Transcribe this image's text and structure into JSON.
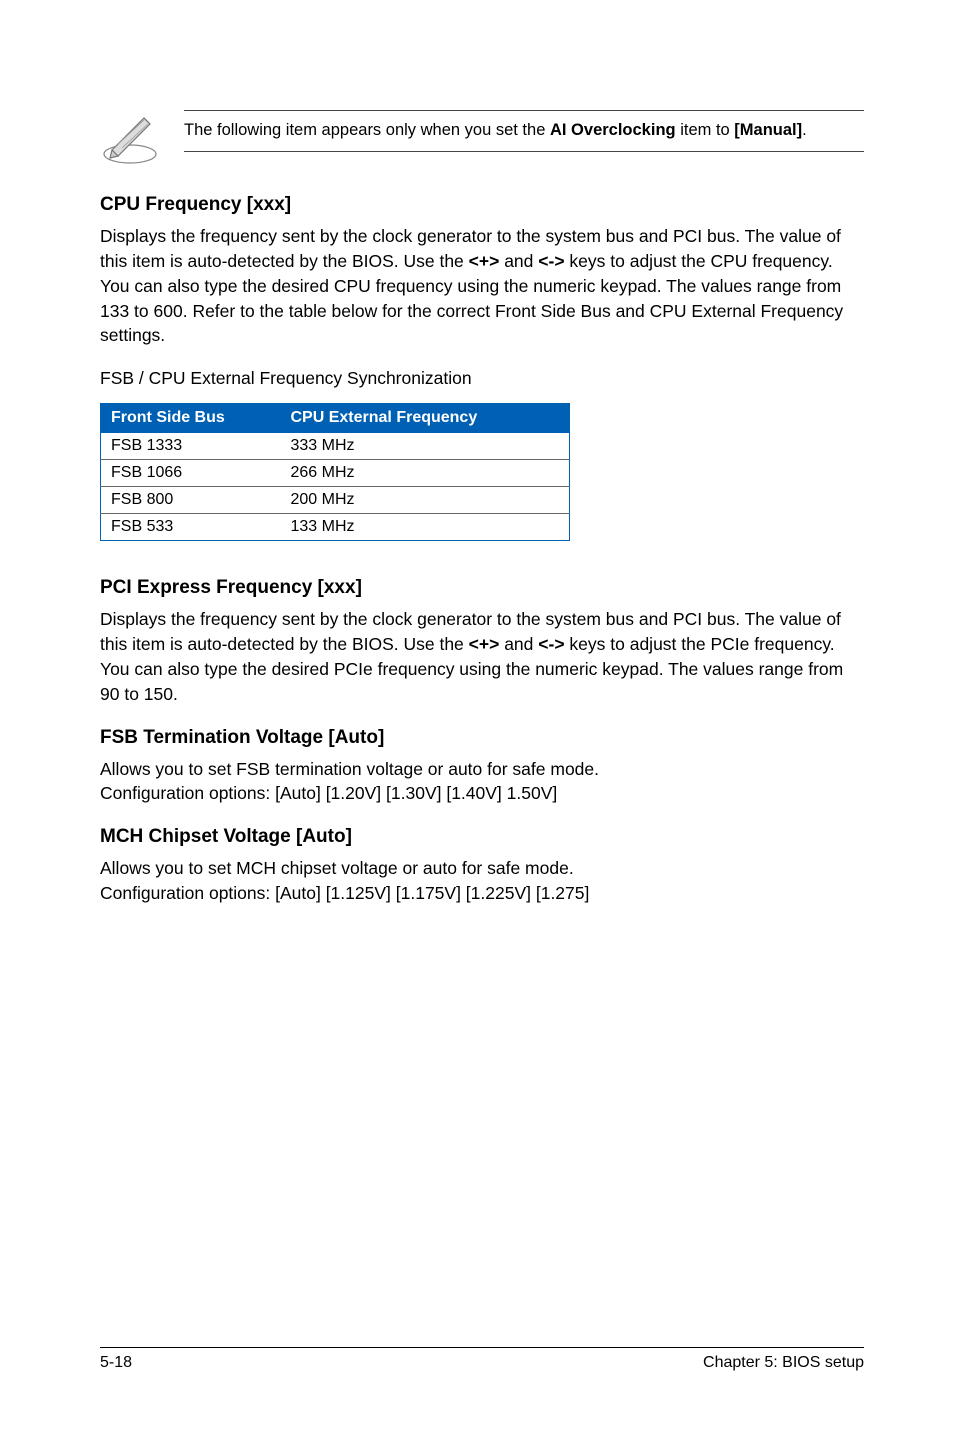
{
  "note": {
    "prefix": "The following item appears only when you set the ",
    "bold": "AI Overclocking",
    "middle": " item to ",
    "bold2": "[Manual]",
    "suffix": "."
  },
  "sections": {
    "cpu_freq": {
      "heading": "CPU Frequency [xxx]",
      "body_a": "Displays the frequency sent by the clock generator to the system bus and PCI bus. The value of this item is auto-detected by the BIOS. Use the ",
      "key1": "<+>",
      "mid": " and ",
      "key2": "<->",
      "body_b": " keys to adjust the CPU frequency. You can also type the desired CPU frequency using the numeric keypad. The values range from 133 to 600. Refer to the table below for the correct Front Side Bus and CPU External Frequency settings.",
      "table_caption": "FSB / CPU External Frequency Synchronization",
      "table": {
        "headers": [
          "Front Side Bus",
          "CPU External Frequency"
        ],
        "rows": [
          [
            "FSB 1333",
            "333 MHz"
          ],
          [
            "FSB 1066",
            "266 MHz"
          ],
          [
            "FSB 800",
            "200 MHz"
          ],
          [
            "FSB 533",
            "133 MHz"
          ]
        ]
      }
    },
    "pcie": {
      "heading": "PCI Express Frequency [xxx]",
      "body_a": "Displays the frequency sent by the clock generator to the system bus and PCI bus. The value of this item is auto-detected by the BIOS. Use the ",
      "key1": "<+>",
      "mid": " and ",
      "key2": "<->",
      "body_b": " keys to adjust the PCIe frequency. You can also type the desired PCIe frequency using the numeric keypad. The values range from 90 to 150."
    },
    "fsb_term": {
      "heading": "FSB Termination Voltage [Auto]",
      "line1": "Allows you to set FSB termination voltage or auto for safe mode.",
      "line2": "Configuration options: [Auto] [1.20V] [1.30V] [1.40V] 1.50V]"
    },
    "mch": {
      "heading": "MCH Chipset Voltage [Auto]",
      "line1": "Allows you to set MCH chipset voltage or auto for safe mode.",
      "line2": "Configuration options: [Auto] [1.125V] [1.175V] [1.225V] [1.275]"
    }
  },
  "footer": {
    "left": "5-18",
    "right": "Chapter 5: BIOS setup"
  }
}
